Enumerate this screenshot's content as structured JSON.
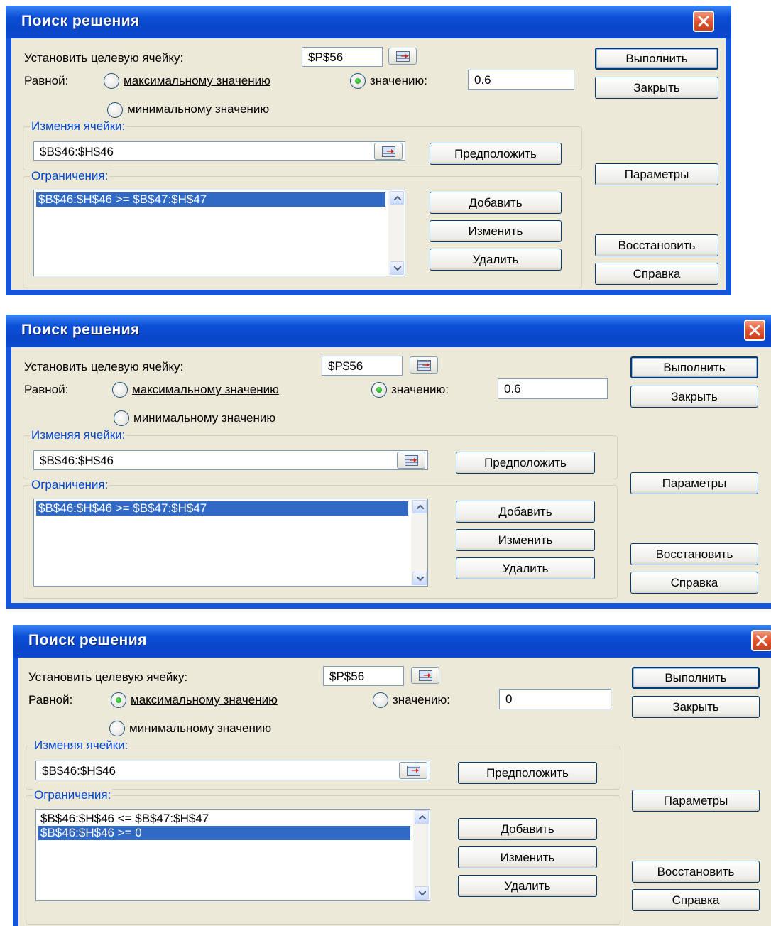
{
  "dialogs": [
    {
      "title": "Поиск решения",
      "target_cell_label": "Установить целевую ячейку:",
      "target_cell_value": "$P$56",
      "equal_label": "Равной:",
      "radio_max_label": "максимальному значению",
      "radio_value_label": "значению:",
      "radio_value_input": "0.6",
      "radio_min_label": "минимальному значению",
      "selected_radio": "value",
      "changing_cells_group": "Изменяя ячейки:",
      "changing_cells_value": "$B$46:$H$46",
      "constraints_group": "Ограничения:",
      "constraints": [
        {
          "text": "$B$46:$H$46 >= $B$47:$H$47",
          "selected": true
        }
      ],
      "buttons": {
        "solve": "Выполнить",
        "close": "Закрыть",
        "guess": "Предположить",
        "options": "Параметры",
        "add": "Добавить",
        "change": "Изменить",
        "delete": "Удалить",
        "reset": "Восстановить",
        "help": "Справка"
      }
    },
    {
      "title": "Поиск решения",
      "target_cell_label": "Установить целевую ячейку:",
      "target_cell_value": "$P$56",
      "equal_label": "Равной:",
      "radio_max_label": "максимальному значению",
      "radio_value_label": "значению:",
      "radio_value_input": "0.6",
      "radio_min_label": "минимальному значению",
      "selected_radio": "value",
      "changing_cells_group": "Изменяя ячейки:",
      "changing_cells_value": "$B$46:$H$46",
      "constraints_group": "Ограничения:",
      "constraints": [
        {
          "text": "$B$46:$H$46 >= $B$47:$H$47",
          "selected": true
        }
      ],
      "buttons": {
        "solve": "Выполнить",
        "close": "Закрыть",
        "guess": "Предположить",
        "options": "Параметры",
        "add": "Добавить",
        "change": "Изменить",
        "delete": "Удалить",
        "reset": "Восстановить",
        "help": "Справка"
      }
    },
    {
      "title": "Поиск решения",
      "target_cell_label": "Установить целевую ячейку:",
      "target_cell_value": "$P$56",
      "equal_label": "Равной:",
      "radio_max_label": "максимальному значению",
      "radio_value_label": "значению:",
      "radio_value_input": "0",
      "radio_min_label": "минимальному значению",
      "selected_radio": "max",
      "changing_cells_group": "Изменяя ячейки:",
      "changing_cells_value": "$B$46:$H$46",
      "constraints_group": "Ограничения:",
      "constraints": [
        {
          "text": "$B$46:$H$46 <= $B$47:$H$47",
          "selected": false
        },
        {
          "text": "$B$46:$H$46 >= 0",
          "selected": true
        }
      ],
      "buttons": {
        "solve": "Выполнить",
        "close": "Закрыть",
        "guess": "Предположить",
        "options": "Параметры",
        "add": "Добавить",
        "change": "Изменить",
        "delete": "Удалить",
        "reset": "Восстановить",
        "help": "Справка"
      }
    }
  ]
}
